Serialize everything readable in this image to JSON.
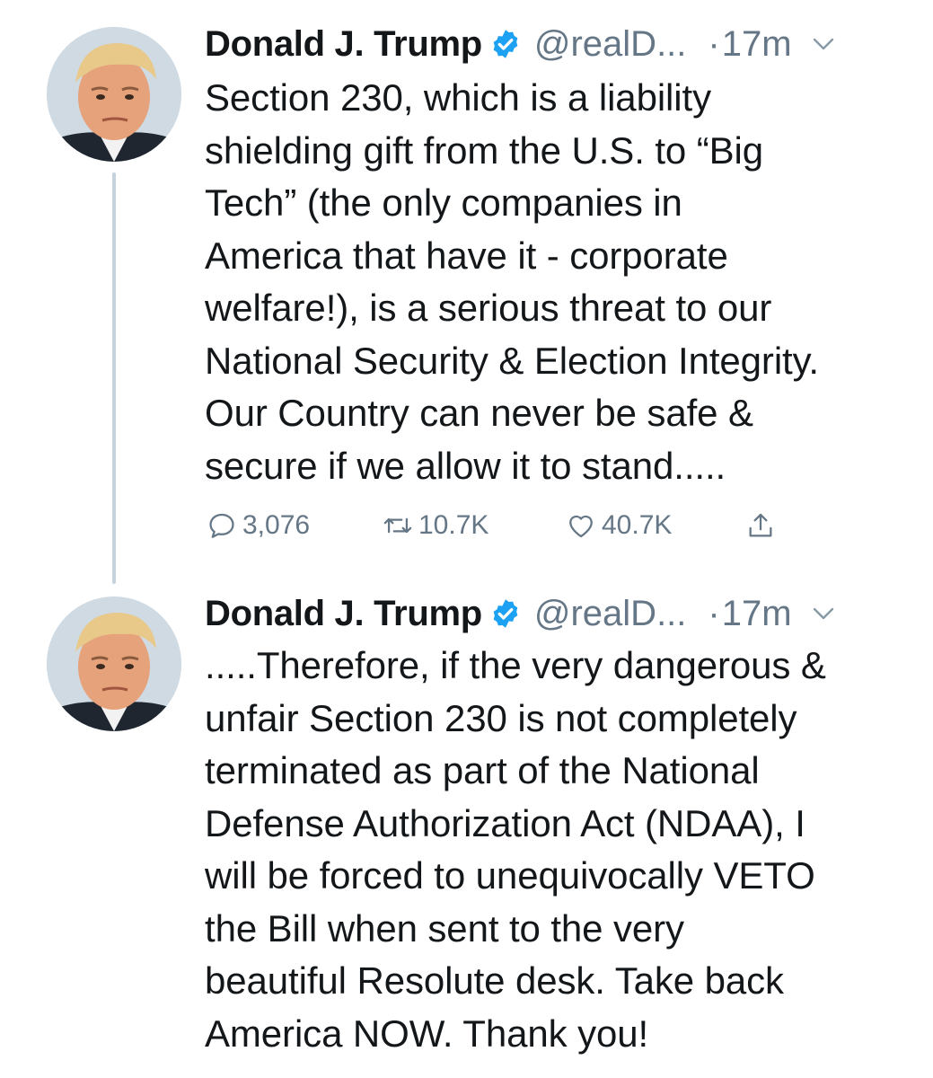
{
  "tweets": [
    {
      "author_name": "Donald J. Trump",
      "handle": "@realD...",
      "separator": "·",
      "time": "17m",
      "text": "Section 230, which is a liability\nshielding gift from the U.S. to “Big\nTech” (the only companies in\nAmerica that have it - corporate\nwelfare!), is a serious threat to our\nNational Security & Election Integrity.\nOur Country can never be safe &\nsecure if we allow it to stand.....",
      "replies": "3,076",
      "retweets": "10.7K",
      "likes": "40.7K"
    },
    {
      "author_name": "Donald J. Trump",
      "handle": "@realD...",
      "separator": "·",
      "time": "17m",
      "text": ".....Therefore, if the very dangerous &\nunfair Section 230 is not completely\nterminated as part of the National\nDefense Authorization Act (NDAA), I\nwill be forced to unequivocally VETO\nthe Bill when sent to the very\nbeautiful Resolute desk. Take back\nAmerica NOW. Thank you!"
    }
  ],
  "icons": {
    "verified": "verified-badge-icon",
    "caret": "chevron-down-icon",
    "reply": "reply-icon",
    "retweet": "retweet-icon",
    "like": "heart-icon",
    "share": "share-icon"
  },
  "colors": {
    "verified_blue": "#1da1f2",
    "secondary_text": "#657786",
    "thread_line": "#c6d3dc"
  }
}
